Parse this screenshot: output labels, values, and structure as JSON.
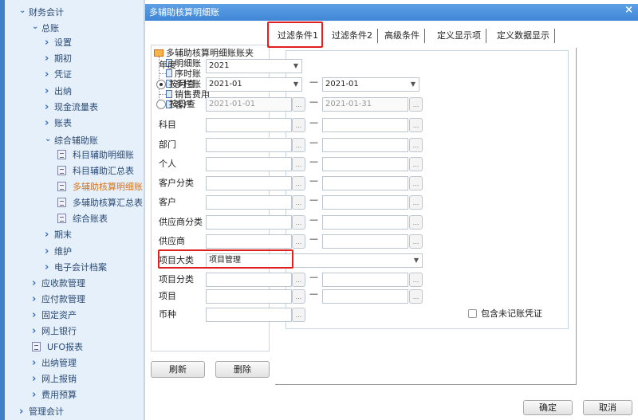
{
  "sidebar": {
    "items": [
      {
        "label": "财务会计",
        "level": 0,
        "icon": "chevron-down"
      },
      {
        "label": "总账",
        "level": 1,
        "icon": "chevron-down"
      },
      {
        "label": "设置",
        "level": 2,
        "icon": "chevron-right"
      },
      {
        "label": "期初",
        "level": 2,
        "icon": "chevron-right"
      },
      {
        "label": "凭证",
        "level": 2,
        "icon": "chevron-right"
      },
      {
        "label": "出纳",
        "level": 2,
        "icon": "chevron-right"
      },
      {
        "label": "现金流量表",
        "level": 2,
        "icon": "chevron-right"
      },
      {
        "label": "账表",
        "level": 2,
        "icon": "chevron-right"
      },
      {
        "label": "综合辅助账",
        "level": 2,
        "icon": "chevron-down"
      },
      {
        "label": "科目辅助明细账",
        "level": 3,
        "icon": "document"
      },
      {
        "label": "科目辅助汇总表",
        "level": 3,
        "icon": "document"
      },
      {
        "label": "多辅助核算明细账",
        "level": 3,
        "icon": "document",
        "active": true
      },
      {
        "label": "多辅助核算汇总表",
        "level": 3,
        "icon": "document"
      },
      {
        "label": "综合账表",
        "level": 3,
        "icon": "document"
      },
      {
        "label": "期末",
        "level": 2,
        "icon": "chevron-right"
      },
      {
        "label": "维护",
        "level": 2,
        "icon": "chevron-right"
      },
      {
        "label": "电子会计档案",
        "level": 2,
        "icon": "chevron-right"
      },
      {
        "label": "应收款管理",
        "level": 1,
        "icon": "chevron-right"
      },
      {
        "label": "应付款管理",
        "level": 1,
        "icon": "chevron-right"
      },
      {
        "label": "固定资产",
        "level": 1,
        "icon": "chevron-right"
      },
      {
        "label": "网上银行",
        "level": 1,
        "icon": "chevron-right"
      },
      {
        "label": "UFO报表",
        "level": 1,
        "icon": "document"
      },
      {
        "label": "出纳管理",
        "level": 1,
        "icon": "chevron-right"
      },
      {
        "label": "网上报销",
        "level": 1,
        "icon": "chevron-right"
      },
      {
        "label": "费用预算",
        "level": 1,
        "icon": "chevron-right"
      },
      {
        "label": "管理会计",
        "level": 0,
        "icon": "chevron-right"
      }
    ]
  },
  "dialog": {
    "title": "多辅助核算明细账",
    "close": "×",
    "tree": {
      "root": "多辅助核算明细账账夹",
      "children": [
        "明细账",
        "序时账",
        "多栏账",
        "销售费用",
        "客户"
      ]
    },
    "refresh_label": "刷新",
    "delete_label": "删除",
    "tabs": [
      "过滤条件1",
      "过滤条件2",
      "高级条件",
      "定义显示项",
      "定义数据显示"
    ],
    "form": {
      "year_label": "年度",
      "year_value": "2021",
      "by_month_label": "按月查",
      "month_from": "2021-01",
      "month_to": "2021-01",
      "by_day_label": "按日查",
      "day_from": "2021-01-01",
      "day_to": "2021-01-31",
      "range_rows": [
        "科目",
        "部门",
        "个人",
        "客户分类",
        "客户",
        "供应商分类",
        "供应商"
      ],
      "project_category_label": "项目大类",
      "project_category_value": "项目管理",
      "range_rows2": [
        "项目分类",
        "项目"
      ],
      "currency_label": "币种",
      "include_unposted_label": "包含未记账凭证",
      "dash": "—",
      "ellipsis": "...",
      "dropdown": "▼"
    },
    "ok_label": "确定",
    "cancel_label": "取消"
  },
  "colors": {
    "accent": "#3f86d6",
    "highlight_box": "#e02020",
    "active_nav": "#d4731c"
  }
}
